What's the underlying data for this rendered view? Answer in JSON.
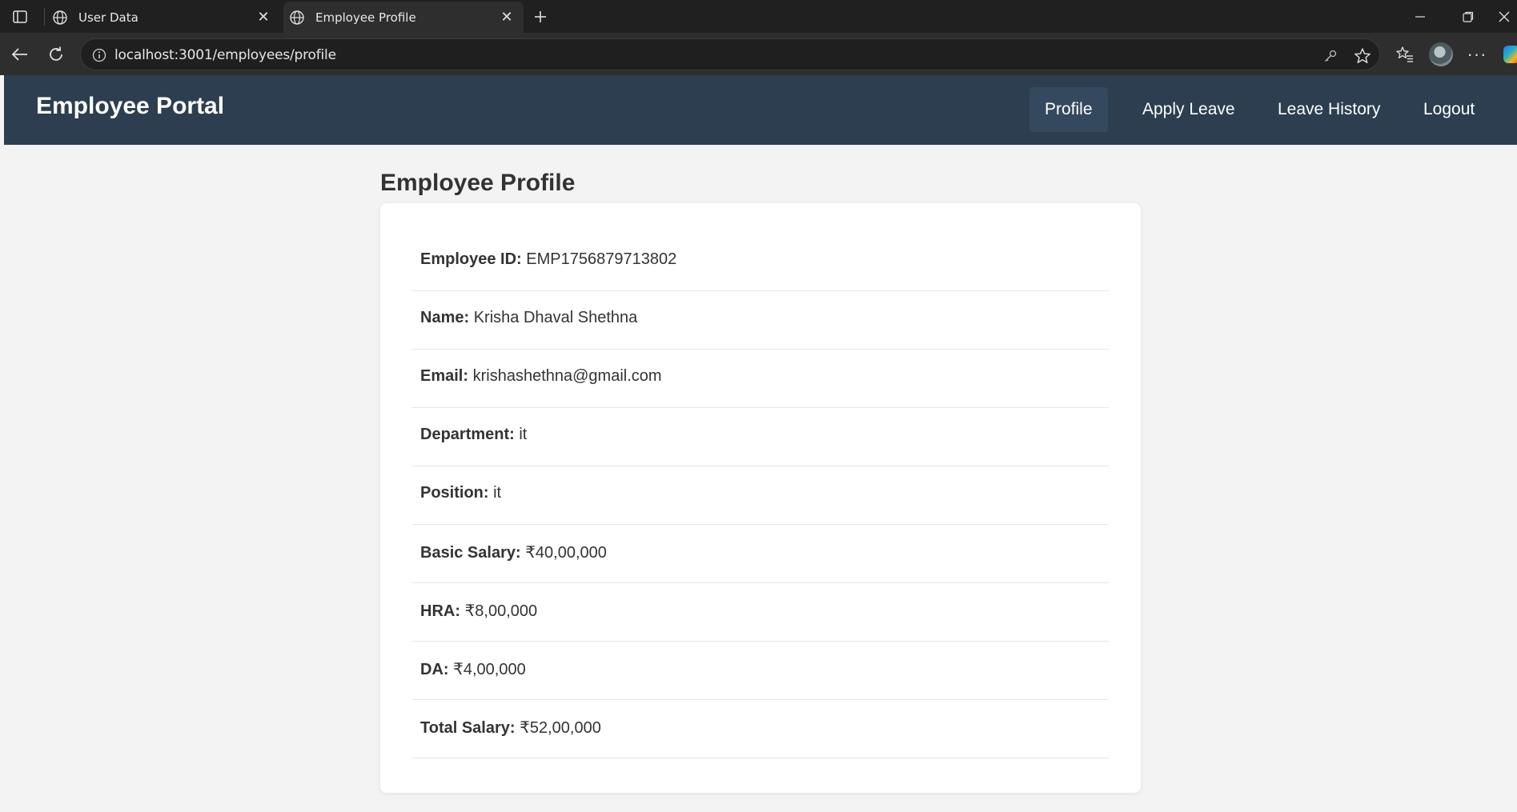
{
  "browser": {
    "tabs": [
      {
        "title": "User Data",
        "active": false
      },
      {
        "title": "Employee Profile",
        "active": true
      }
    ],
    "url": "localhost:3001/employees/profile"
  },
  "navbar": {
    "brand": "Employee Portal",
    "links": [
      {
        "label": "Profile",
        "active": true
      },
      {
        "label": "Apply Leave",
        "active": false
      },
      {
        "label": "Leave History",
        "active": false
      },
      {
        "label": "Logout",
        "active": false
      }
    ]
  },
  "profile": {
    "title": "Employee Profile",
    "fields": [
      {
        "label": "Employee ID:",
        "value": "EMP1756879713802"
      },
      {
        "label": "Name:",
        "value": "Krisha Dhaval Shethna"
      },
      {
        "label": "Email:",
        "value": "krishashethna@gmail.com"
      },
      {
        "label": "Department:",
        "value": "it"
      },
      {
        "label": "Position:",
        "value": "it"
      },
      {
        "label": "Basic Salary:",
        "value": "₹40,00,000"
      },
      {
        "label": "HRA:",
        "value": "₹8,00,000"
      },
      {
        "label": "DA:",
        "value": "₹4,00,000"
      },
      {
        "label": "Total Salary:",
        "value": "₹52,00,000"
      }
    ]
  },
  "colors": {
    "navbar": "#2c3e50",
    "navbar_active": "#34495e",
    "page_bg": "#f3f3f3",
    "card_bg": "#ffffff",
    "text": "#333333"
  },
  "icons": [
    "sidebar-toggle-icon",
    "globe-icon",
    "close-icon",
    "plus-icon",
    "minimize-icon",
    "restore-icon",
    "window-close-icon",
    "back-arrow-icon",
    "refresh-icon",
    "info-icon",
    "key-icon",
    "star-icon",
    "favorites-icon",
    "more-icon",
    "copilot-icon"
  ]
}
